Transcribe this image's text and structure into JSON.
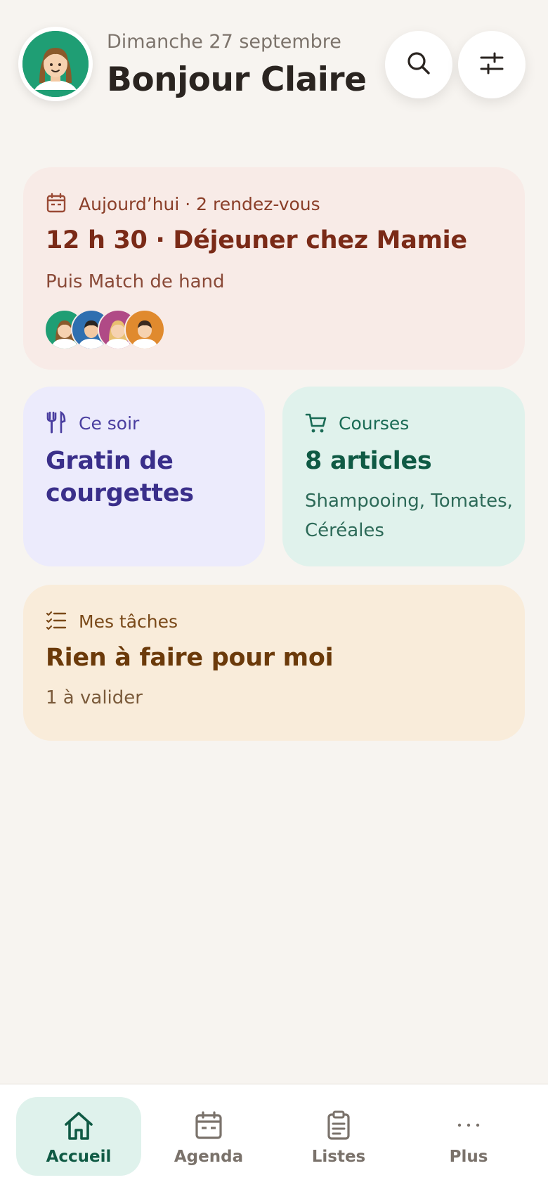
{
  "header": {
    "date": "Dimanche 27 septembre",
    "greeting": "Bonjour Claire",
    "avatar_icon": "user-avatar-claire",
    "search_icon": "search-icon",
    "filter_icon": "sliders-icon"
  },
  "today": {
    "label": "Aujourd’hui · 2 rendez-vous",
    "title": "12 h 30 · Déjeuner chez Mamie",
    "next": "Puis Match de hand",
    "icon": "calendar-icon",
    "accent": "#7a2a17"
  },
  "dinner": {
    "label": "Ce soir",
    "title_line1": "Gratin de",
    "title_line2": "courgettes",
    "icon": "utensils-icon",
    "accent": "#3a2f8a"
  },
  "shopping": {
    "label": "Courses",
    "title": "8 articles",
    "items_line1": "Shampooing, Tomates,",
    "items_line2": "Céréales",
    "icon": "cart-icon",
    "accent": "#0f5a44"
  },
  "tasks": {
    "label": "Mes tâches",
    "title": "Rien à faire pour moi",
    "sub": "1 à valider",
    "icon": "checklist-icon",
    "accent": "#6b3a0a"
  },
  "nav": {
    "items": [
      {
        "label": "Accueil",
        "icon": "home-icon"
      },
      {
        "label": "Agenda",
        "icon": "calendar-icon"
      },
      {
        "label": "Listes",
        "icon": "clipboard-icon"
      },
      {
        "label": "Plus",
        "icon": "more-icon"
      }
    ]
  }
}
